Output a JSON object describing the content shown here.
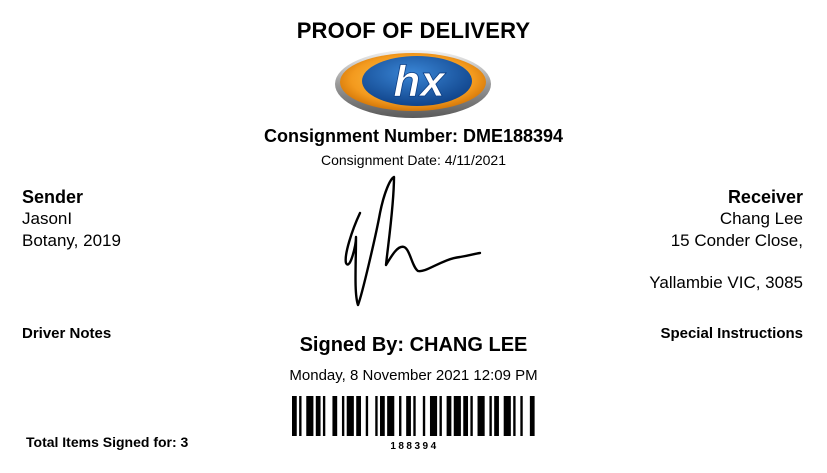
{
  "title": "PROOF OF DELIVERY",
  "logo": {
    "text": "hx",
    "colors": {
      "orange": "#f39a1e",
      "blue": "#1b5ca8",
      "silver": "#c9c9c9"
    }
  },
  "consignment": {
    "number_label": "Consignment Number: DME188394",
    "date_label": "Consignment Date: 4/11/2021"
  },
  "sender": {
    "heading": "Sender",
    "lines": [
      "JasonI",
      "Botany, 2019"
    ]
  },
  "receiver": {
    "heading": "Receiver",
    "lines": [
      "Chang Lee",
      "15 Conder Close,",
      "Yallambie VIC, 3085"
    ]
  },
  "driver_notes_label": "Driver Notes",
  "special_instructions_label": "Special Instructions",
  "signed_by": "Signed By: CHANG LEE",
  "signed_datetime": "Monday, 8 November 2021 12:09 PM",
  "total_items": "Total Items Signed for: 3",
  "barcode_number": "188394"
}
